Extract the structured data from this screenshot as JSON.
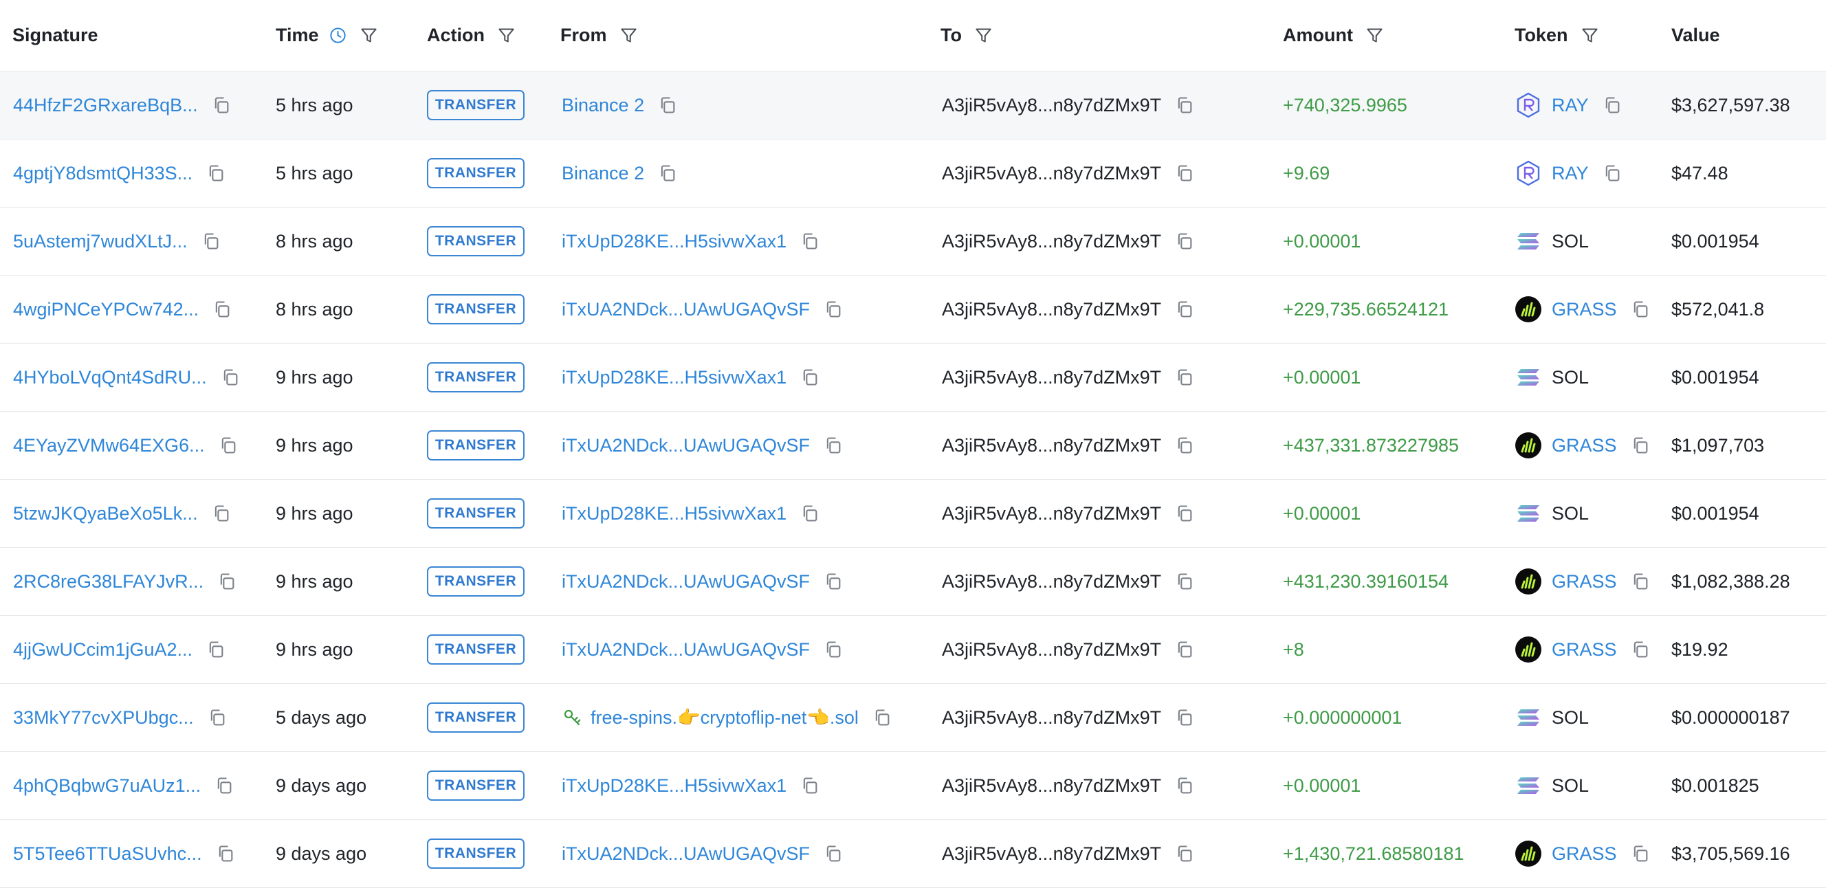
{
  "columns": {
    "signature": "Signature",
    "time": "Time",
    "action": "Action",
    "from": "From",
    "to": "To",
    "amount": "Amount",
    "token": "Token",
    "value": "Value"
  },
  "colors": {
    "link": "#2f86d9",
    "positive_amount": "#3e9b46",
    "badge": "#3a86d4",
    "highlight_row": "#f6f7f8"
  },
  "rows": [
    {
      "signature": "44HfzF2GRxareBqB...",
      "time": "5 hrs ago",
      "action": "TRANSFER",
      "from": "Binance 2",
      "from_icon": "",
      "to": "A3jiR5vAy8...n8y7dZMx9T",
      "amount": "+740,325.9965",
      "token": "RAY",
      "token_icon": "raydium-icon",
      "value": "$3,627,597.38"
    },
    {
      "signature": "4gptjY8dsmtQH33S...",
      "time": "5 hrs ago",
      "action": "TRANSFER",
      "from": "Binance 2",
      "from_icon": "",
      "to": "A3jiR5vAy8...n8y7dZMx9T",
      "amount": "+9.69",
      "token": "RAY",
      "token_icon": "raydium-icon",
      "value": "$47.48"
    },
    {
      "signature": "5uAstemj7wudXLtJ...",
      "time": "8 hrs ago",
      "action": "TRANSFER",
      "from": "iTxUpD28KE...H5sivwXax1",
      "from_icon": "",
      "to": "A3jiR5vAy8...n8y7dZMx9T",
      "amount": "+0.00001",
      "token": "SOL",
      "token_icon": "solana-icon",
      "value": "$0.001954"
    },
    {
      "signature": "4wgiPNCeYPCw742...",
      "time": "8 hrs ago",
      "action": "TRANSFER",
      "from": "iTxUA2NDck...UAwUGAQvSF",
      "from_icon": "",
      "to": "A3jiR5vAy8...n8y7dZMx9T",
      "amount": "+229,735.66524121",
      "token": "GRASS",
      "token_icon": "grass-icon",
      "value": "$572,041.8"
    },
    {
      "signature": "4HYboLVqQnt4SdRU...",
      "time": "9 hrs ago",
      "action": "TRANSFER",
      "from": "iTxUpD28KE...H5sivwXax1",
      "from_icon": "",
      "to": "A3jiR5vAy8...n8y7dZMx9T",
      "amount": "+0.00001",
      "token": "SOL",
      "token_icon": "solana-icon",
      "value": "$0.001954"
    },
    {
      "signature": "4EYayZVMw64EXG6...",
      "time": "9 hrs ago",
      "action": "TRANSFER",
      "from": "iTxUA2NDck...UAwUGAQvSF",
      "from_icon": "",
      "to": "A3jiR5vAy8...n8y7dZMx9T",
      "amount": "+437,331.873227985",
      "token": "GRASS",
      "token_icon": "grass-icon",
      "value": "$1,097,703"
    },
    {
      "signature": "5tzwJKQyaBeXo5Lk...",
      "time": "9 hrs ago",
      "action": "TRANSFER",
      "from": "iTxUpD28KE...H5sivwXax1",
      "from_icon": "",
      "to": "A3jiR5vAy8...n8y7dZMx9T",
      "amount": "+0.00001",
      "token": "SOL",
      "token_icon": "solana-icon",
      "value": "$0.001954"
    },
    {
      "signature": "2RC8reG38LFAYJvR...",
      "time": "9 hrs ago",
      "action": "TRANSFER",
      "from": "iTxUA2NDck...UAwUGAQvSF",
      "from_icon": "",
      "to": "A3jiR5vAy8...n8y7dZMx9T",
      "amount": "+431,230.39160154",
      "token": "GRASS",
      "token_icon": "grass-icon",
      "value": "$1,082,388.28"
    },
    {
      "signature": "4jjGwUCcim1jGuA2...",
      "time": "9 hrs ago",
      "action": "TRANSFER",
      "from": "iTxUA2NDck...UAwUGAQvSF",
      "from_icon": "",
      "to": "A3jiR5vAy8...n8y7dZMx9T",
      "amount": "+8",
      "token": "GRASS",
      "token_icon": "grass-icon",
      "value": "$19.92"
    },
    {
      "signature": "33MkY77cvXPUbgc...",
      "time": "5 days ago",
      "action": "TRANSFER",
      "from": "free-spins.👉cryptoflip-net👈.sol",
      "from_icon": "domain-tag-icon",
      "to": "A3jiR5vAy8...n8y7dZMx9T",
      "amount": "+0.000000001",
      "token": "SOL",
      "token_icon": "solana-icon",
      "value": "$0.000000187"
    },
    {
      "signature": "4phQBqbwG7uAUz1...",
      "time": "9 days ago",
      "action": "TRANSFER",
      "from": "iTxUpD28KE...H5sivwXax1",
      "from_icon": "",
      "to": "A3jiR5vAy8...n8y7dZMx9T",
      "amount": "+0.00001",
      "token": "SOL",
      "token_icon": "solana-icon",
      "value": "$0.001825"
    },
    {
      "signature": "5T5Tee6TTUaSUvhc...",
      "time": "9 days ago",
      "action": "TRANSFER",
      "from": "iTxUA2NDck...UAwUGAQvSF",
      "from_icon": "",
      "to": "A3jiR5vAy8...n8y7dZMx9T",
      "amount": "+1,430,721.68580181",
      "token": "GRASS",
      "token_icon": "grass-icon",
      "value": "$3,705,569.16"
    }
  ]
}
